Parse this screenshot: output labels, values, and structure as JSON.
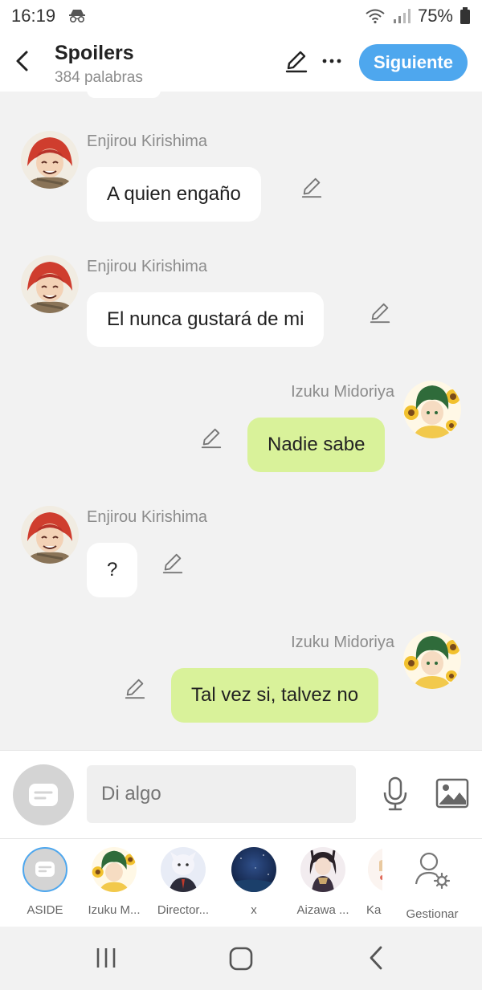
{
  "status": {
    "time": "16:19",
    "battery": "75%"
  },
  "header": {
    "title": "Spoilers",
    "subtitle": "384 palabras",
    "next_label": "Siguiente"
  },
  "messages": [
    {
      "sender": "Enjirou Kirishima",
      "text": "A quien engaño",
      "side": "left"
    },
    {
      "sender": "Enjirou Kirishima",
      "text": "El nunca gustará de mi",
      "side": "left"
    },
    {
      "sender": "Izuku Midoriya",
      "text": "Nadie sabe",
      "side": "right"
    },
    {
      "sender": "Enjirou Kirishima",
      "text": "?",
      "side": "left"
    },
    {
      "sender": "Izuku Midoriya",
      "text": "Tal vez si, talvez no",
      "side": "right"
    }
  ],
  "composer": {
    "placeholder": "Di algo"
  },
  "characters": [
    {
      "label": "ASIDE"
    },
    {
      "label": "Izuku M..."
    },
    {
      "label": "Director..."
    },
    {
      "label": "x"
    },
    {
      "label": "Aizawa ..."
    },
    {
      "label": "Ka"
    },
    {
      "label": "Gestionar"
    }
  ],
  "colors": {
    "accent": "#4ea7ee",
    "own_bubble": "#d9f29a",
    "other_bubble": "#ffffff",
    "background": "#f2f2f2"
  },
  "icons": {
    "status": [
      "incognito-icon",
      "wifi-icon",
      "signal-icon",
      "battery-icon"
    ],
    "header": [
      "back-arrow-icon",
      "pencil-icon",
      "more-icon"
    ],
    "composer": [
      "aside-icon",
      "microphone-icon",
      "image-icon"
    ],
    "nav": [
      "recents-icon",
      "home-icon",
      "back-icon"
    ]
  }
}
